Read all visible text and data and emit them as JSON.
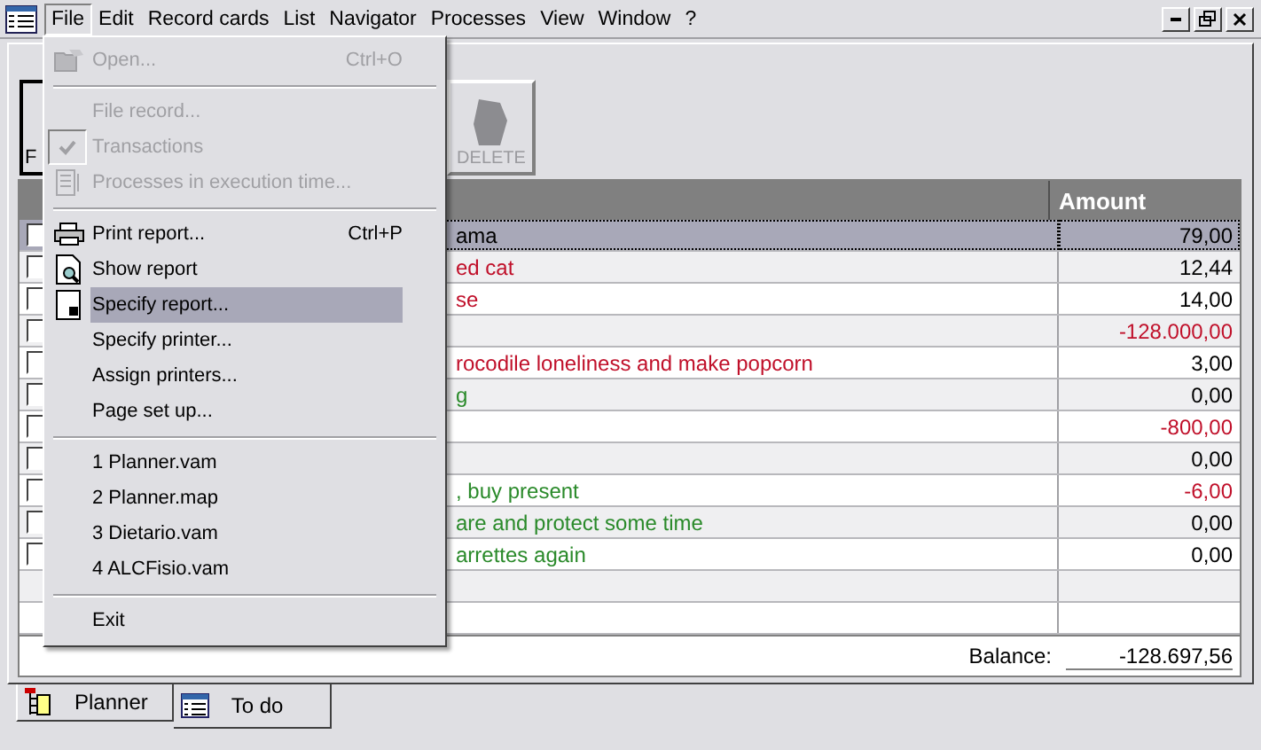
{
  "menubar": {
    "items": [
      {
        "label": "File",
        "selected": true
      },
      {
        "label": "Edit",
        "selected": false
      },
      {
        "label": "Record cards",
        "selected": false
      },
      {
        "label": "List",
        "selected": false
      },
      {
        "label": "Navigator",
        "selected": false
      },
      {
        "label": "Processes",
        "selected": false
      },
      {
        "label": "View",
        "selected": false
      },
      {
        "label": "Window",
        "selected": false
      },
      {
        "label": "?",
        "selected": false
      }
    ]
  },
  "toolbar": {
    "buttons": [
      {
        "label": "F",
        "disabled": false
      },
      {
        "label": "DELETE",
        "disabled": true
      }
    ]
  },
  "table": {
    "columns": [
      {
        "label": "Amount"
      }
    ],
    "rows": [
      {
        "checked": false,
        "selected": true,
        "description": {
          "text": "ama",
          "color": "#000000"
        },
        "amount": {
          "text": "79,00",
          "color": "#000000"
        }
      },
      {
        "checked": false,
        "selected": false,
        "description": {
          "text": "ed cat",
          "color": "#c0102a"
        },
        "amount": {
          "text": "12,44",
          "color": "#000000"
        }
      },
      {
        "checked": false,
        "selected": false,
        "description": {
          "text": "se",
          "color": "#c0102a"
        },
        "amount": {
          "text": "14,00",
          "color": "#000000"
        }
      },
      {
        "checked": false,
        "selected": false,
        "amount": {
          "text": "-128.000,00",
          "color": "#c0102a"
        }
      },
      {
        "checked": false,
        "selected": false,
        "description": {
          "text": "rocodile loneliness and make popcorn",
          "color": "#c0102a"
        },
        "amount": {
          "text": "3,00",
          "color": "#000000"
        }
      },
      {
        "checked": false,
        "selected": false,
        "description": {
          "text": "g",
          "color": "#2a8a2a"
        },
        "amount": {
          "text": "0,00",
          "color": "#000000"
        }
      },
      {
        "checked": false,
        "selected": false,
        "amount": {
          "text": "-800,00",
          "color": "#c0102a"
        }
      },
      {
        "checked": false,
        "selected": false,
        "amount": {
          "text": "0,00",
          "color": "#000000"
        }
      },
      {
        "checked": false,
        "selected": false,
        "description": {
          "text": ", buy present",
          "color": "#2a8a2a"
        },
        "amount": {
          "text": "-6,00",
          "color": "#c0102a"
        }
      },
      {
        "checked": false,
        "selected": false,
        "description": {
          "text": "are and protect some time",
          "color": "#2a8a2a"
        },
        "amount": {
          "text": "0,00",
          "color": "#000000"
        }
      },
      {
        "checked": false,
        "selected": false,
        "description": {
          "text": "arrettes again",
          "color": "#2a8a2a"
        },
        "amount": {
          "text": "0,00",
          "color": "#000000"
        }
      }
    ]
  },
  "balance": {
    "label": "Balance:",
    "value": "-128.697,56"
  },
  "tabs": [
    {
      "label": "Planner",
      "selected": false
    },
    {
      "label": "To do",
      "selected": true
    }
  ],
  "file_menu": {
    "items": [
      {
        "kind": "item",
        "label": "Open...",
        "shortcut": "Ctrl+O",
        "disabled": true,
        "selected": false
      },
      {
        "kind": "separator"
      },
      {
        "kind": "item",
        "label": "File record...",
        "disabled": true,
        "selected": false
      },
      {
        "kind": "item",
        "label": "Transactions",
        "disabled": true,
        "selected": false,
        "checked": true
      },
      {
        "kind": "item",
        "label": "Processes in execution time...",
        "disabled": true,
        "selected": false
      },
      {
        "kind": "separator"
      },
      {
        "kind": "item",
        "label": "Print report...",
        "shortcut": "Ctrl+P",
        "disabled": false,
        "selected": false
      },
      {
        "kind": "item",
        "label": "Show report",
        "disabled": false,
        "selected": false
      },
      {
        "kind": "item",
        "label": "Specify report...",
        "disabled": false,
        "selected": true
      },
      {
        "kind": "item",
        "label": "Specify printer...",
        "disabled": false,
        "selected": false
      },
      {
        "kind": "item",
        "label": "Assign printers...",
        "disabled": false,
        "selected": false
      },
      {
        "kind": "item",
        "label": "Page set up...",
        "disabled": false,
        "selected": false
      },
      {
        "kind": "separator"
      },
      {
        "kind": "item",
        "label": "1 Planner.vam",
        "disabled": false,
        "selected": false
      },
      {
        "kind": "item",
        "label": "2 Planner.map",
        "disabled": false,
        "selected": false
      },
      {
        "kind": "item",
        "label": "3 Dietario.vam",
        "disabled": false,
        "selected": false
      },
      {
        "kind": "item",
        "label": "4 ALCFisio.vam",
        "disabled": false,
        "selected": false
      },
      {
        "kind": "separator"
      },
      {
        "kind": "item",
        "label": "Exit",
        "disabled": false,
        "selected": false
      }
    ]
  }
}
